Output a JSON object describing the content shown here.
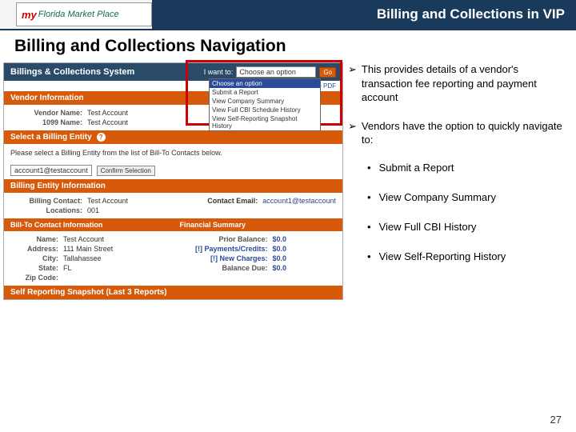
{
  "header": {
    "logo_my": "my",
    "logo_rest": "Florida Market Place",
    "title": "Billing and Collections in VIP"
  },
  "section_heading": "Billing and Collections Navigation",
  "shot": {
    "sys_title": "Billings & Collections System",
    "iwantto": "I want to:",
    "dropdown_selected": "Choose an option",
    "dropdown_options": [
      "Choose an option",
      "Submit a Report",
      "View Company Summary",
      "View Full CBI Schedule History",
      "View Self-Reporting Snapshot History"
    ],
    "go": "Go",
    "html_link": "HTML | Adobe PDF",
    "vendor_info": {
      "hdr": "Vendor Information",
      "name_lbl": "Vendor Name:",
      "name_val": "Test Account",
      "tax_lbl": "1099 Name:",
      "tax_val": "Test Account"
    },
    "select_entity": {
      "hdr": "Select a Billing Entity",
      "q": "?",
      "instr": "Please select a Billing Entity from the list of Bill-To Contacts below.",
      "selected": "account1@testaccount",
      "confirm": "Confirm Selection"
    },
    "billing_entity_info": {
      "hdr": "Billing Entity Information",
      "contact_lbl": "Billing Contact:",
      "contact_val": "Test Account",
      "email_lbl": "Contact Email:",
      "email_val": "account1@testaccount",
      "loc_lbl": "Locations:",
      "loc_val": "001"
    },
    "billto": {
      "hdr": "Bill-To Contact Information",
      "name_lbl": "Name:",
      "name_val": "Test Account",
      "addr_lbl": "Address:",
      "addr_val": "111 Main Street",
      "city_lbl": "City:",
      "city_val": "Tallahassee",
      "state_lbl": "State:",
      "state_val": "FL",
      "zip_lbl": "Zip Code:",
      "zip_val": ""
    },
    "fin": {
      "hdr": "Financial Summary",
      "prior_lbl": "Prior Balance:",
      "prior_val": "$0.0",
      "pay_lbl": "[!] Payments/Credits:",
      "pay_val": "$0.0",
      "new_lbl": "[!] New Charges:",
      "new_val": "$0.0",
      "due_lbl": "Balance Due:",
      "due_val": "$0.0"
    },
    "snapshot_hdr": "Self Reporting Snapshot (Last 3 Reports)"
  },
  "bullets": {
    "b1": "This provides details of a vendor's transaction fee reporting and payment account",
    "b2": "Vendors have the option to quickly navigate to:",
    "subs": [
      "Submit a Report",
      "View Company Summary",
      "View Full CBI History",
      "View Self-Reporting History"
    ]
  },
  "page_num": "27"
}
